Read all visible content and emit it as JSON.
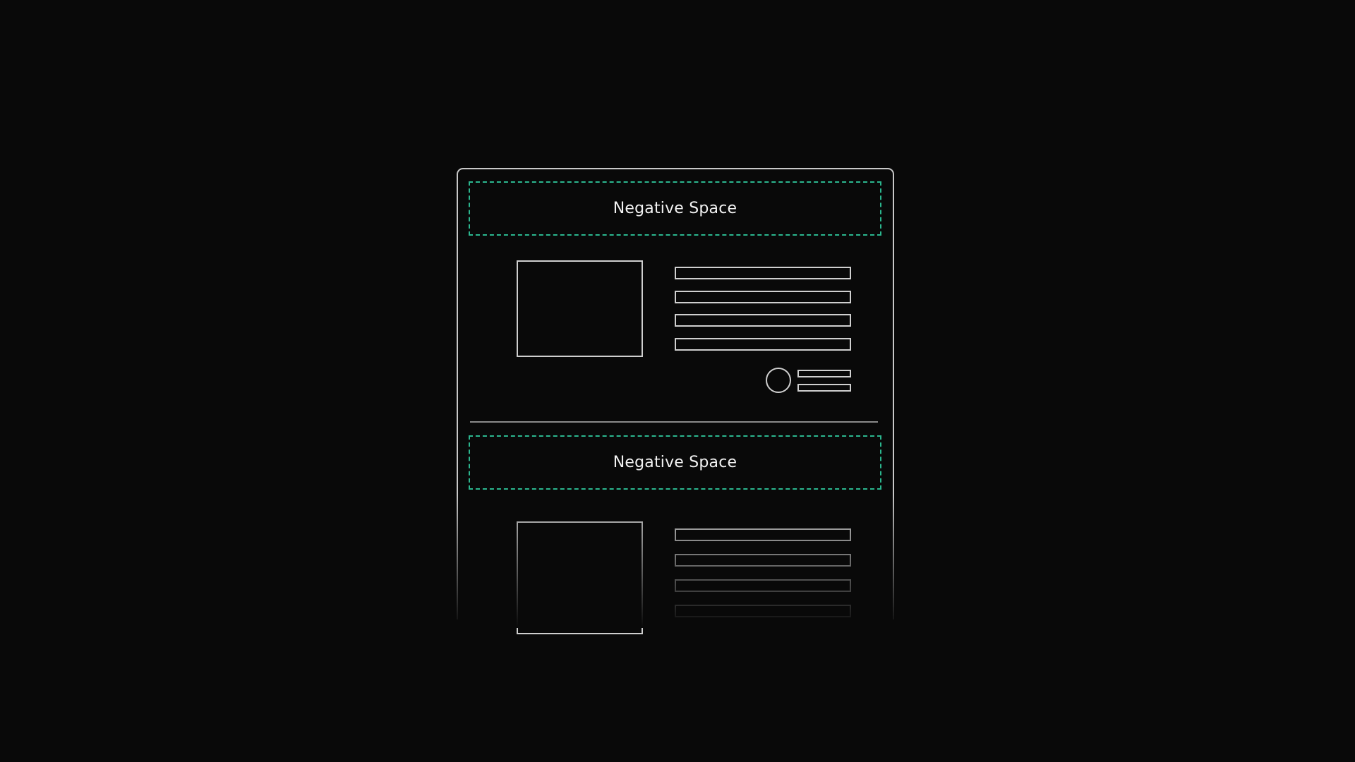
{
  "sections": [
    {
      "negative_space_label": "Negative Space"
    },
    {
      "negative_space_label": "Negative Space"
    }
  ],
  "colors": {
    "background": "#090909",
    "outline": "#cfcfcf",
    "accent_dashed": "#2bb68e",
    "text": "#f2f2f2"
  }
}
